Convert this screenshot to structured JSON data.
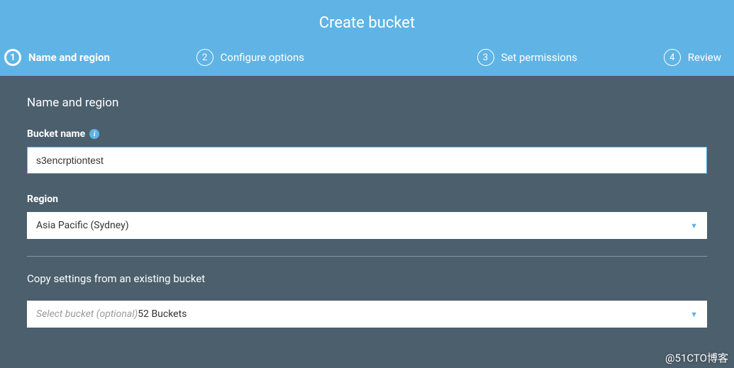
{
  "title": "Create bucket",
  "steps": [
    {
      "num": "1",
      "label": "Name and region",
      "active": true
    },
    {
      "num": "2",
      "label": "Configure options",
      "active": false
    },
    {
      "num": "3",
      "label": "Set permissions",
      "active": false
    },
    {
      "num": "4",
      "label": "Review",
      "active": false
    }
  ],
  "form": {
    "section_heading": "Name and region",
    "bucket_name_label": "Bucket name",
    "bucket_name_value": "s3encrptiontest",
    "region_label": "Region",
    "region_value": "Asia Pacific (Sydney)",
    "copy_heading": "Copy settings from an existing bucket",
    "copy_placeholder": "Select bucket (optional)",
    "copy_count": "52 Buckets"
  },
  "watermark": "@51CTO博客"
}
